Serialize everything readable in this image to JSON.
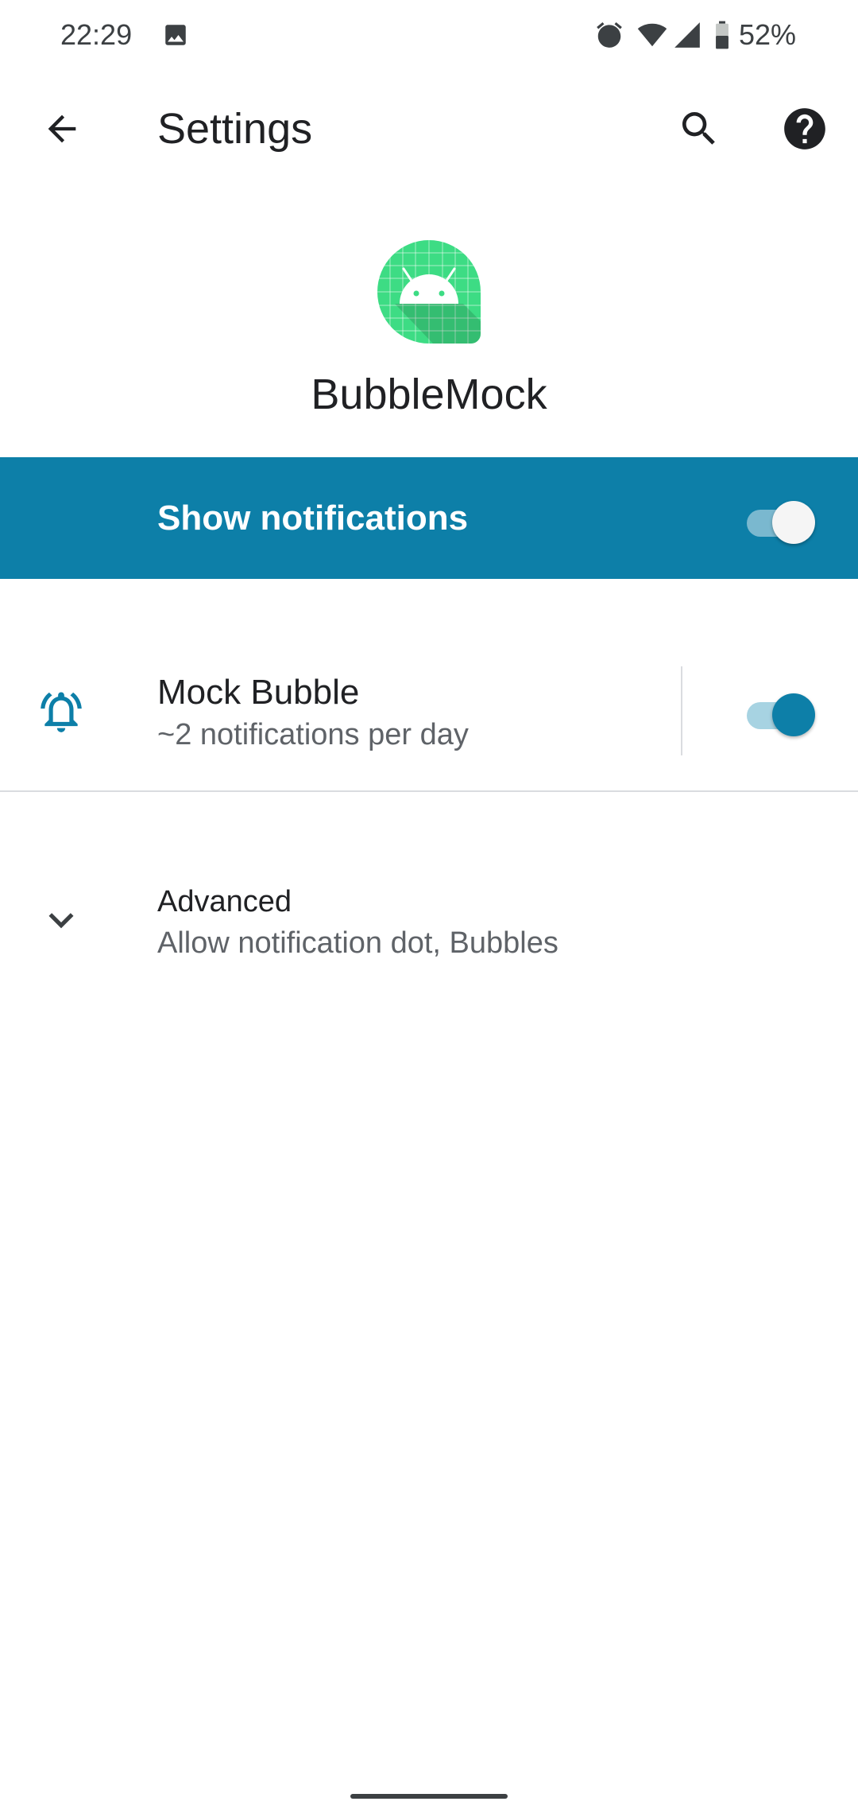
{
  "status_bar": {
    "time": "22:29",
    "battery_percent": "52%",
    "icons": [
      "gallery-icon",
      "alarm-icon",
      "wifi-icon",
      "signal-icon",
      "battery-icon"
    ]
  },
  "app_bar": {
    "title": "Settings",
    "icons": [
      "back-arrow-icon",
      "search-icon",
      "help-icon"
    ]
  },
  "app_header": {
    "name": "BubbleMock",
    "icon": "android-app-icon"
  },
  "master_switch": {
    "label": "Show notifications",
    "checked": true,
    "background_color": "#0d7fa8"
  },
  "channels": [
    {
      "icon": "notification-bell-icon",
      "title": "Mock Bubble",
      "summary": "~2 notifications per day",
      "checked": true
    }
  ],
  "advanced": {
    "icon": "chevron-down-icon",
    "title": "Advanced",
    "summary": "Allow notification dot, Bubbles"
  },
  "colors": {
    "accent": "#0d7fa8",
    "app_icon_green": "#3ddc84"
  }
}
